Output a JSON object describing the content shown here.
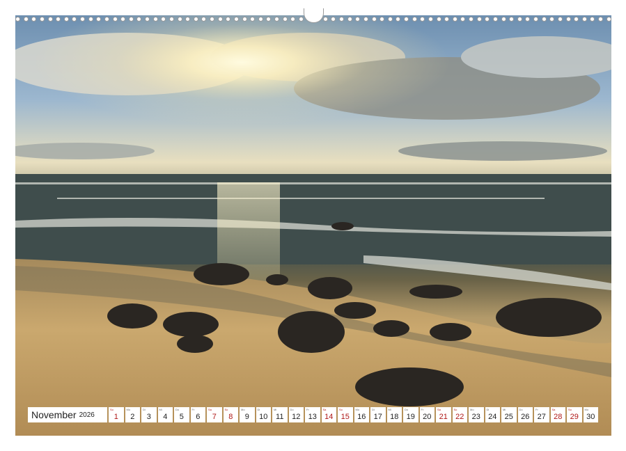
{
  "calendar": {
    "month": "November",
    "year": "2026",
    "days": [
      {
        "abbr": "So",
        "num": "1",
        "weekend": true
      },
      {
        "abbr": "Mo",
        "num": "2",
        "weekend": false
      },
      {
        "abbr": "Di",
        "num": "3",
        "weekend": false
      },
      {
        "abbr": "Mi",
        "num": "4",
        "weekend": false
      },
      {
        "abbr": "Do",
        "num": "5",
        "weekend": false
      },
      {
        "abbr": "Fr",
        "num": "6",
        "weekend": false
      },
      {
        "abbr": "Sa",
        "num": "7",
        "weekend": true
      },
      {
        "abbr": "So",
        "num": "8",
        "weekend": true
      },
      {
        "abbr": "Mo",
        "num": "9",
        "weekend": false
      },
      {
        "abbr": "Di",
        "num": "10",
        "weekend": false
      },
      {
        "abbr": "Mi",
        "num": "11",
        "weekend": false
      },
      {
        "abbr": "Do",
        "num": "12",
        "weekend": false
      },
      {
        "abbr": "Fr",
        "num": "13",
        "weekend": false
      },
      {
        "abbr": "Sa",
        "num": "14",
        "weekend": true
      },
      {
        "abbr": "So",
        "num": "15",
        "weekend": true
      },
      {
        "abbr": "Mo",
        "num": "16",
        "weekend": false
      },
      {
        "abbr": "Di",
        "num": "17",
        "weekend": false
      },
      {
        "abbr": "Mi",
        "num": "18",
        "weekend": false
      },
      {
        "abbr": "Do",
        "num": "19",
        "weekend": false
      },
      {
        "abbr": "Fr",
        "num": "20",
        "weekend": false
      },
      {
        "abbr": "Sa",
        "num": "21",
        "weekend": true
      },
      {
        "abbr": "So",
        "num": "22",
        "weekend": true
      },
      {
        "abbr": "Mo",
        "num": "23",
        "weekend": false
      },
      {
        "abbr": "Di",
        "num": "24",
        "weekend": false
      },
      {
        "abbr": "Mi",
        "num": "25",
        "weekend": false
      },
      {
        "abbr": "Do",
        "num": "26",
        "weekend": false
      },
      {
        "abbr": "Fr",
        "num": "27",
        "weekend": false
      },
      {
        "abbr": "Sa",
        "num": "28",
        "weekend": true
      },
      {
        "abbr": "So",
        "num": "29",
        "weekend": true
      },
      {
        "abbr": "Mo",
        "num": "30",
        "weekend": false
      }
    ]
  },
  "colors": {
    "weekend": "#b01818",
    "weekday": "#222222",
    "binding": "#9a9a9a"
  }
}
